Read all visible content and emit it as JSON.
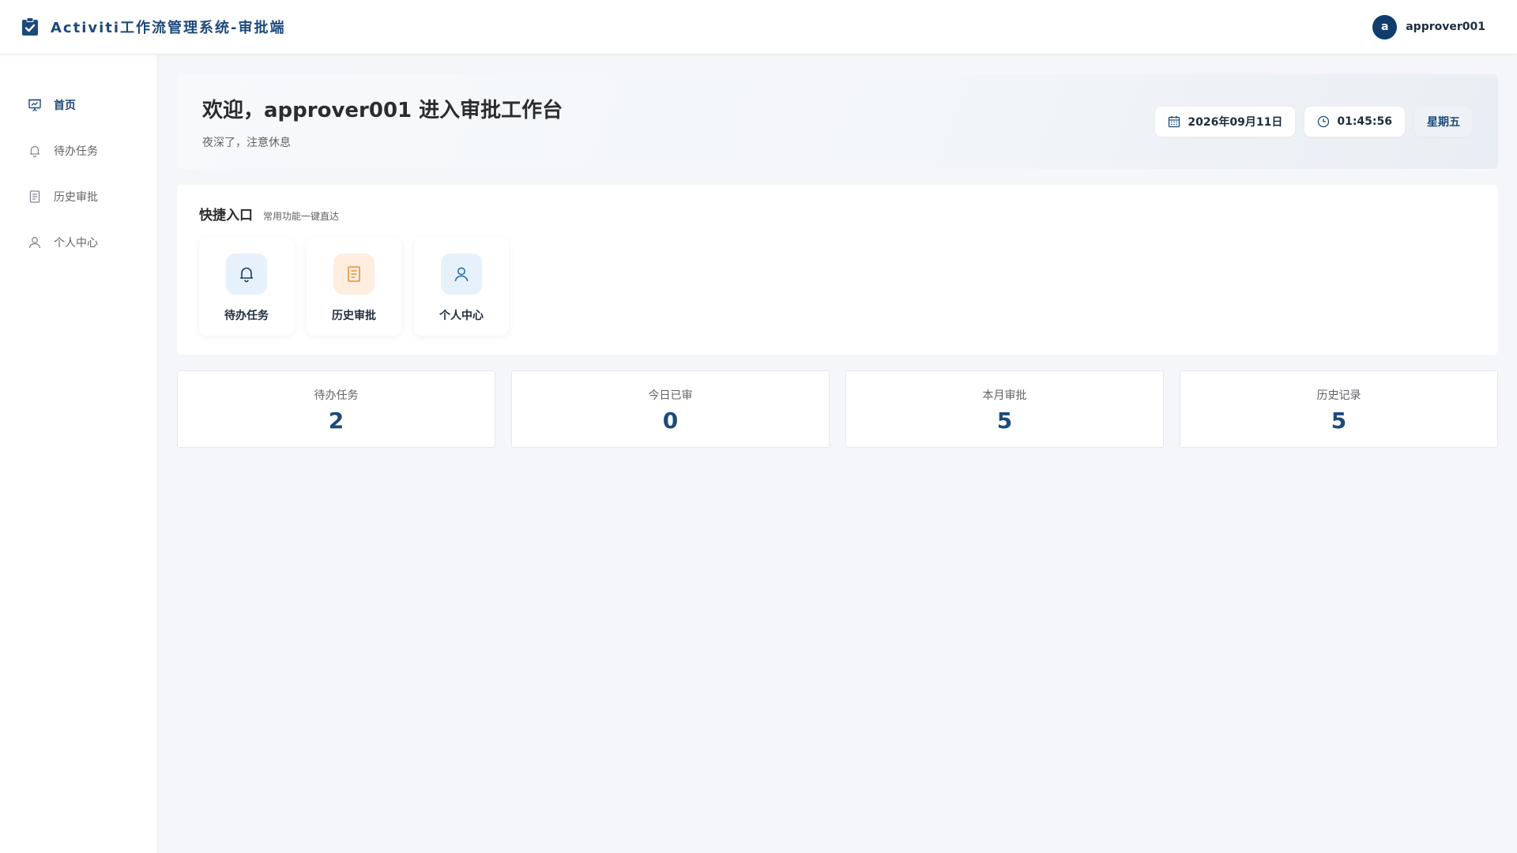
{
  "header": {
    "title": "Activiti工作流管理系统-审批端",
    "avatar_letter": "a",
    "username": "approver001"
  },
  "sidebar": {
    "items": [
      {
        "label": "首页",
        "icon": "presentation-icon",
        "active": true
      },
      {
        "label": "待办任务",
        "icon": "bell-icon"
      },
      {
        "label": "历史审批",
        "icon": "document-icon"
      },
      {
        "label": "个人中心",
        "icon": "user-icon"
      }
    ]
  },
  "welcome": {
    "title": "欢迎，approver001 进入审批工作台",
    "subtitle": "夜深了，注意休息",
    "date": "2026年09月11日",
    "time": "01:45:56",
    "weekday": "星期五"
  },
  "quick": {
    "title": "快捷入口",
    "subtitle": "常用功能一键直达",
    "cards": [
      {
        "label": "待办任务",
        "icon": "bell-icon"
      },
      {
        "label": "历史审批",
        "icon": "document-icon"
      },
      {
        "label": "个人中心",
        "icon": "user-icon"
      }
    ]
  },
  "stats": [
    {
      "label": "待办任务",
      "value": "2"
    },
    {
      "label": "今日已审",
      "value": "0"
    },
    {
      "label": "本月审批",
      "value": "5"
    },
    {
      "label": "历史记录",
      "value": "5"
    }
  ],
  "colors": {
    "brand": "#1e4a7a",
    "avatar_bg": "#0f3d6e",
    "page_bg": "#f4f6f9",
    "orange_accent": "#e8913a"
  }
}
